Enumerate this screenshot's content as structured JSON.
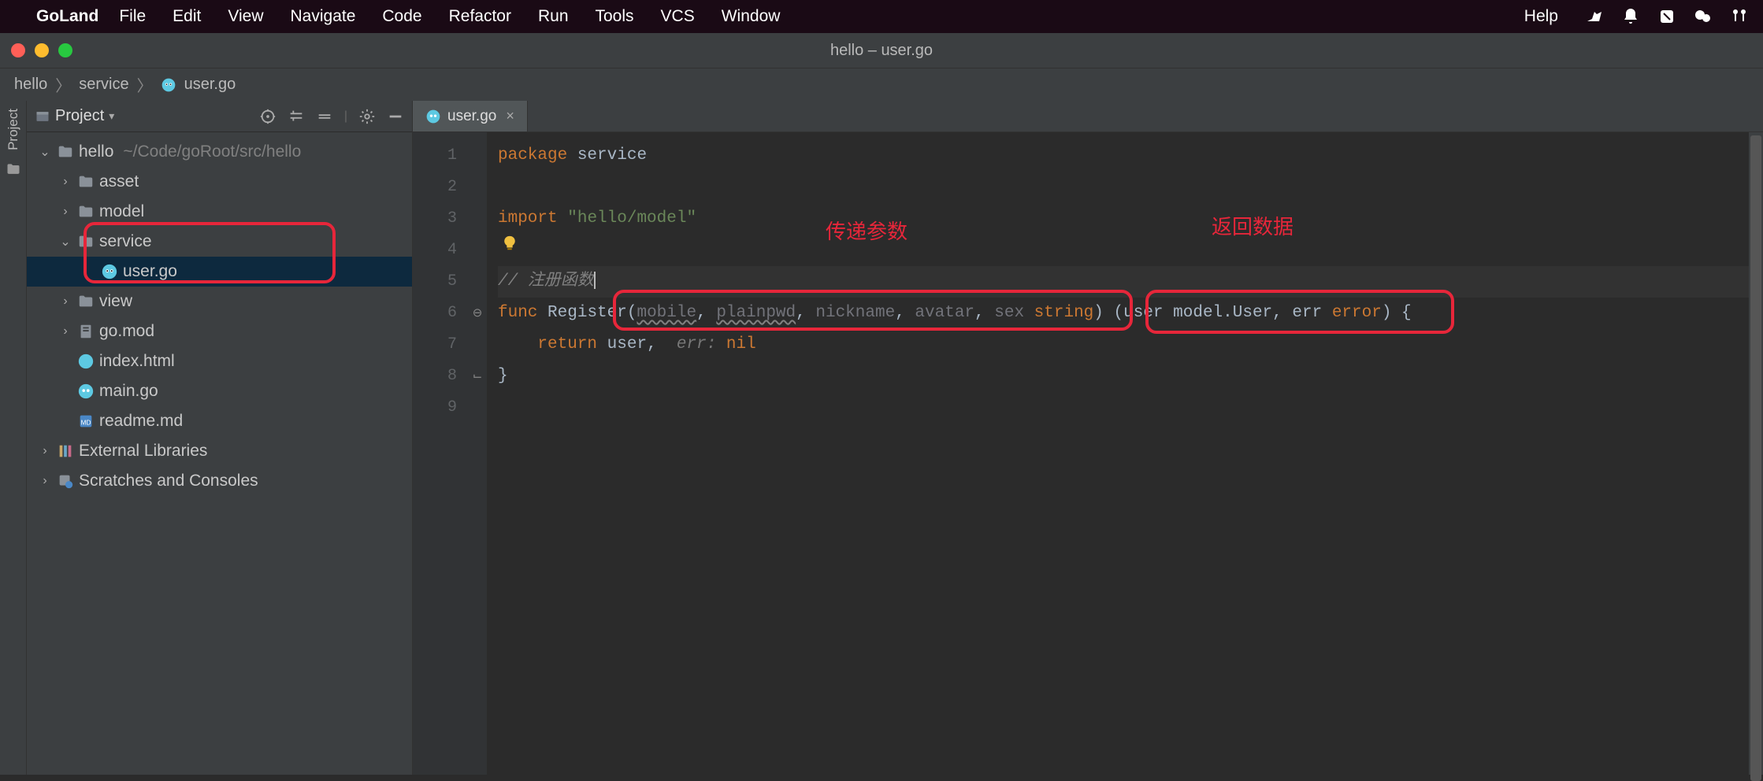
{
  "mac_menu": {
    "app": "GoLand",
    "items": [
      "File",
      "Edit",
      "View",
      "Navigate",
      "Code",
      "Refactor",
      "Run",
      "Tools",
      "VCS",
      "Window"
    ],
    "help": "Help"
  },
  "window": {
    "title": "hello – user.go"
  },
  "breadcrumb": {
    "a": "hello",
    "b": "service",
    "c": "user.go"
  },
  "project_pane": {
    "title": "Project"
  },
  "tree": {
    "root": {
      "name": "hello",
      "path": "~/Code/goRoot/src/hello"
    },
    "asset": "asset",
    "model": "model",
    "service": "service",
    "user_go": "user.go",
    "view": "view",
    "go_mod": "go.mod",
    "index_html": "index.html",
    "main_go": "main.go",
    "readme": "readme.md",
    "ext_lib": "External Libraries",
    "scratches": "Scratches and Consoles"
  },
  "tab": {
    "name": "user.go"
  },
  "line_numbers": [
    "1",
    "2",
    "3",
    "4",
    "5",
    "6",
    "7",
    "8",
    "9"
  ],
  "code": {
    "l1_kw": "package",
    "l1_id": "service",
    "l3_kw": "import",
    "l3_str": "\"hello/model\"",
    "l5_comment": "// 注册函数",
    "l6_func": "func",
    "l6_name": "Register",
    "l6_p1": "mobile",
    "l6_p2": "plainpwd",
    "l6_p3": "nickname",
    "l6_p4": "avatar",
    "l6_p5": "sex",
    "l6_ptype": "string",
    "l6_r1": "user",
    "l6_r1_type": "model.User",
    "l6_r2": "err",
    "l6_r2_type": "error",
    "l7_kw": "return",
    "l7_a": "user",
    "l7_hint": "err:",
    "l7_b": "nil",
    "l8": "}"
  },
  "annotations": {
    "params": "传递参数",
    "returns": "返回数据"
  }
}
